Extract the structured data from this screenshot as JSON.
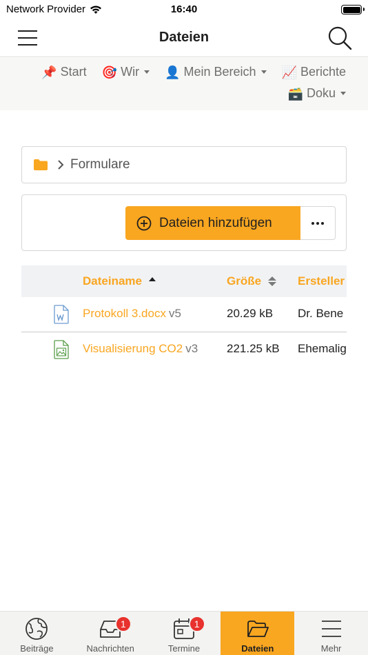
{
  "status_bar": {
    "carrier": "Network Provider",
    "time": "16:40"
  },
  "header": {
    "title": "Dateien"
  },
  "top_nav": {
    "items": [
      {
        "label": "Start",
        "emoji": "📌",
        "icon": "pushpin-icon",
        "has_dropdown": false
      },
      {
        "label": "Wir",
        "emoji": "🎯",
        "icon": "target-icon",
        "has_dropdown": true
      },
      {
        "label": "Mein Bereich",
        "emoji": "👤",
        "icon": "user-icon",
        "has_dropdown": true
      },
      {
        "label": "Berichte",
        "emoji": "📈",
        "icon": "chart-icon",
        "has_dropdown": false
      },
      {
        "label": "Doku",
        "emoji": "🗃️",
        "icon": "card-box-icon",
        "has_dropdown": true
      }
    ]
  },
  "breadcrumb": {
    "folder": "Formulare"
  },
  "actions": {
    "add_label": "Dateien hinzufügen"
  },
  "table": {
    "columns": [
      {
        "label": "Dateiname",
        "sort": "ascending"
      },
      {
        "label": "Größe",
        "sort": "none"
      },
      {
        "label": "Ersteller",
        "sort": "none"
      }
    ],
    "rows": [
      {
        "name": "Protokoll 3.docx",
        "version": "v5",
        "size": "20.29 kB",
        "creator": "Dr. Bene",
        "icon": "word-document-icon"
      },
      {
        "name": "Visualisierung CO2",
        "version": "v3",
        "size": "221.25 kB",
        "creator": "Ehemalig",
        "icon": "image-file-icon"
      }
    ]
  },
  "tab_bar": {
    "tabs": [
      {
        "label": "Beiträge",
        "icon": "globe-icon",
        "badge": ""
      },
      {
        "label": "Nachrichten",
        "icon": "inbox-icon",
        "badge": "1"
      },
      {
        "label": "Termine",
        "icon": "calendar-icon",
        "badge": "1"
      },
      {
        "label": "Dateien",
        "icon": "folder-open-icon",
        "badge": "",
        "active": true
      },
      {
        "label": "Mehr",
        "icon": "menu-icon",
        "badge": ""
      }
    ]
  },
  "colors": {
    "accent": "#f9a620",
    "badge": "#e8322d",
    "word_icon": "#6b9bd1",
    "image_icon": "#5a9e4b"
  }
}
